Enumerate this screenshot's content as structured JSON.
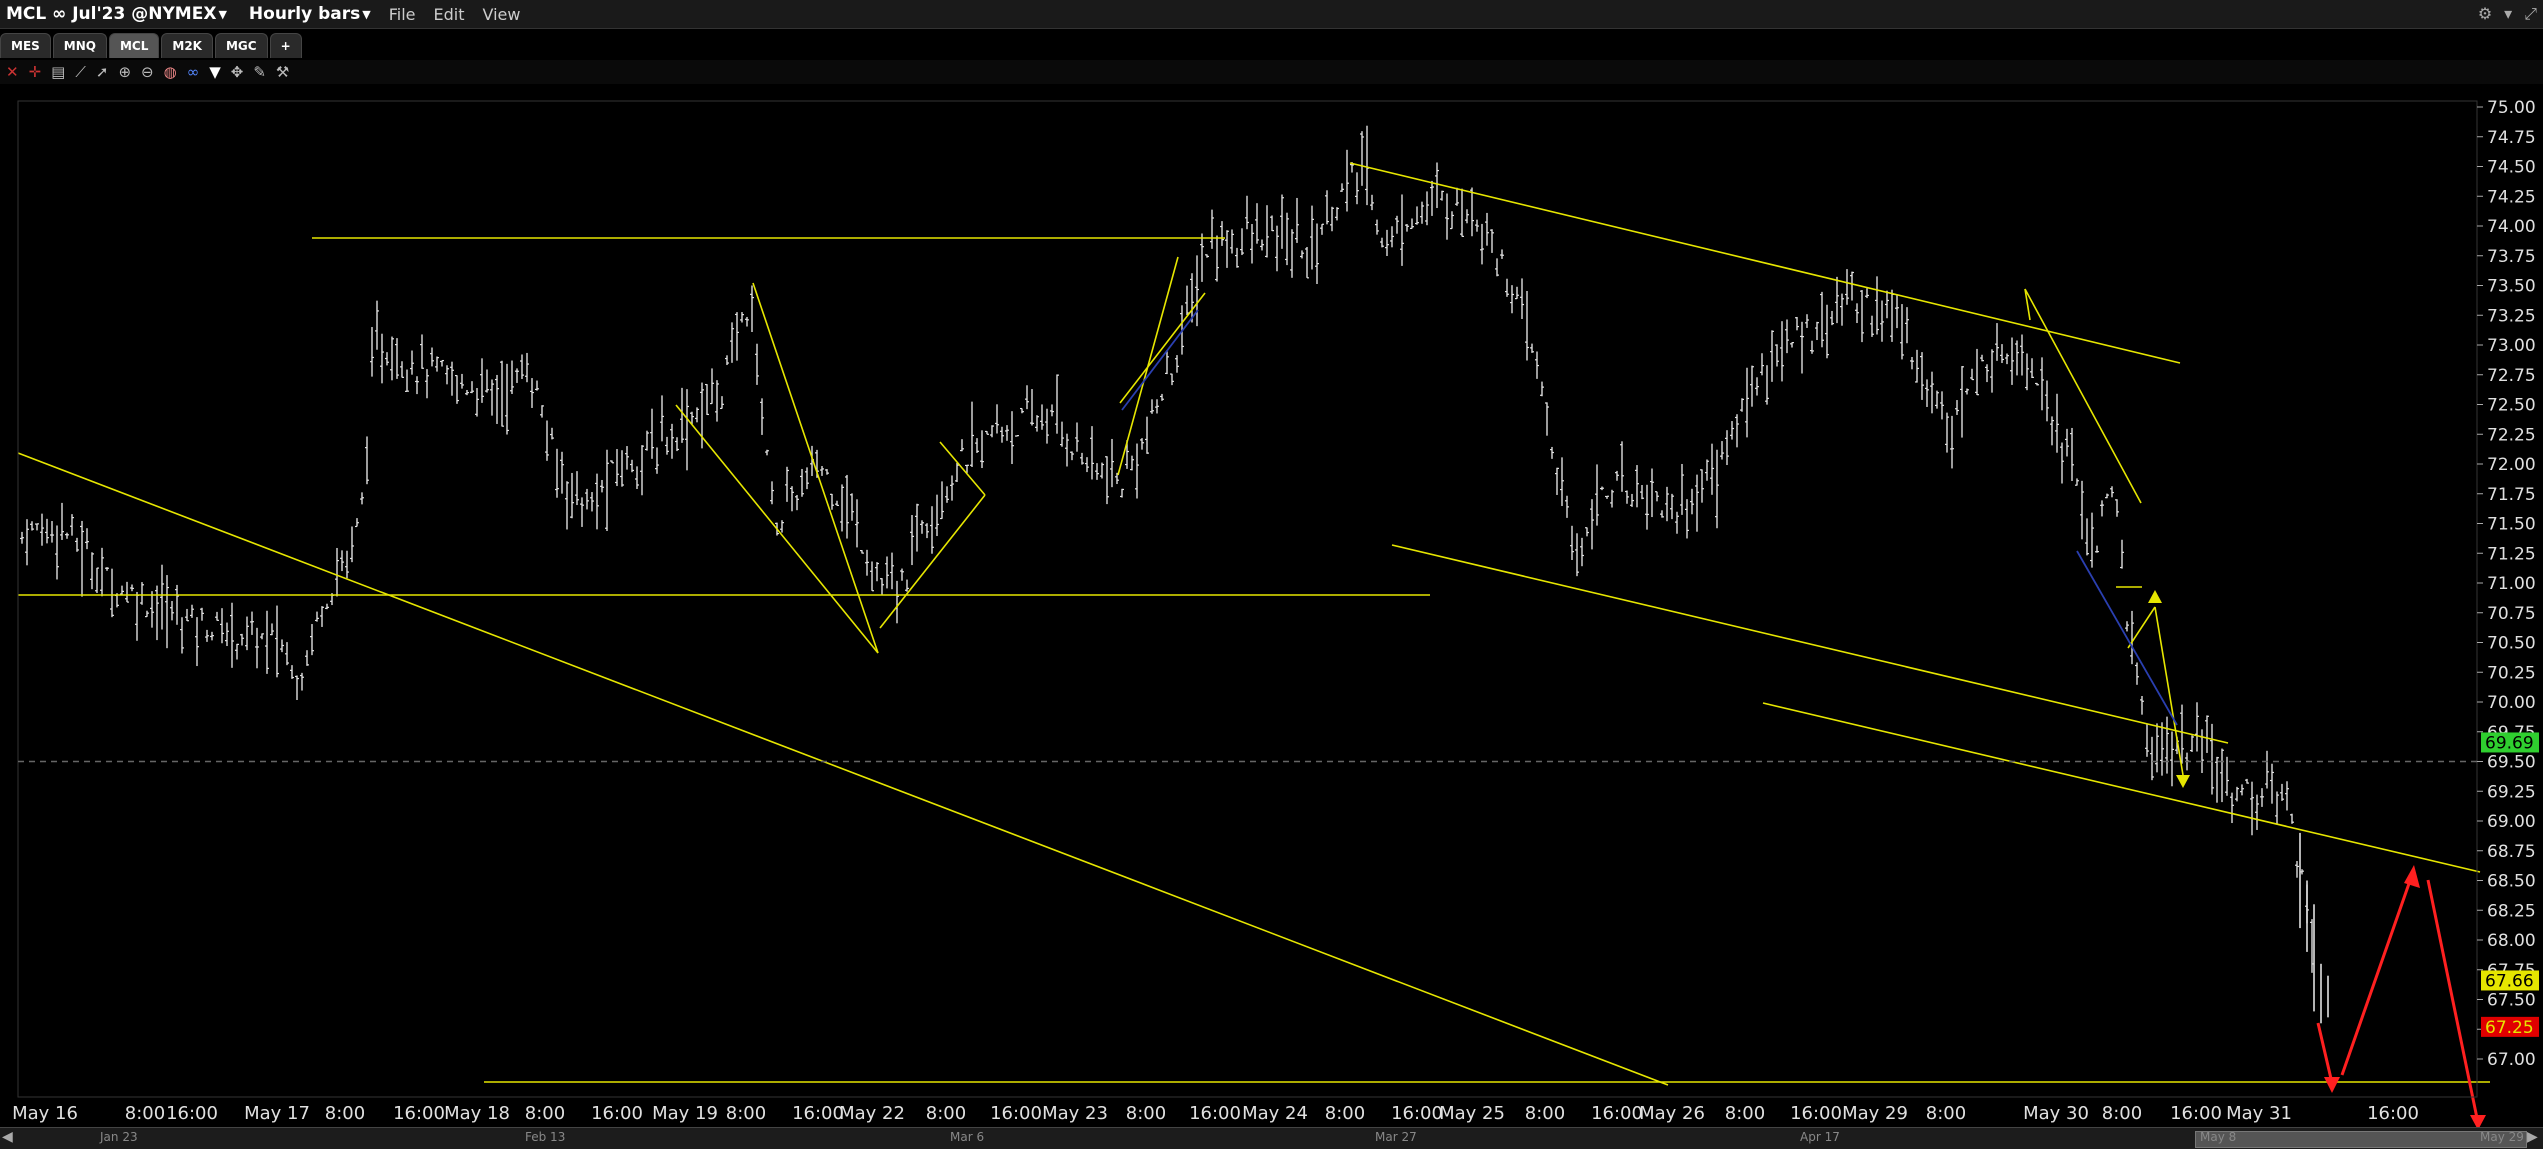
{
  "window": {
    "symbol": "MCL ∞ Jul'23 @NYMEX",
    "bar_type": "Hourly bars",
    "menu": [
      "File",
      "Edit",
      "View"
    ]
  },
  "tabs": [
    {
      "label": "MES",
      "active": false
    },
    {
      "label": "MNQ",
      "active": false
    },
    {
      "label": "MCL",
      "active": true
    },
    {
      "label": "M2K",
      "active": false
    },
    {
      "label": "MGC",
      "active": false
    },
    {
      "label": "+",
      "active": false
    }
  ],
  "toolbar_icons": [
    "close-icon",
    "crosshair-icon",
    "price-icon",
    "line-tool-icon",
    "pointer-icon",
    "zoom-in-icon",
    "zoom-out-icon",
    "globe-icon",
    "link-icon",
    "filter-icon",
    "move-icon",
    "paint-icon",
    "wrench-icon"
  ],
  "chart_data": {
    "type": "ohlc",
    "y_ticks": [
      75.0,
      74.75,
      74.5,
      74.25,
      74.0,
      73.75,
      73.5,
      73.25,
      73.0,
      72.75,
      72.5,
      72.25,
      72.0,
      71.75,
      71.5,
      71.25,
      71.0,
      70.75,
      70.5,
      70.25,
      70.0,
      69.75,
      69.5,
      69.25,
      69.0,
      68.75,
      68.5,
      68.25,
      68.0,
      67.75,
      67.5,
      67.25,
      67.0
    ],
    "y_range": [
      66.72,
      75.18
    ],
    "x_labels": [
      "May 16",
      "8:00",
      "16:00",
      "May 17",
      "8:00",
      "16:00",
      "May 18",
      "8:00",
      "16:00",
      "May 19",
      "8:00",
      "16:00",
      "May 22",
      "8:00",
      "16:00",
      "May 23",
      "8:00",
      "16:00",
      "May 24",
      "8:00",
      "16:00",
      "May 25",
      "8:00",
      "16:00",
      "May 26",
      "8:00",
      "16:00",
      "May 29",
      "8:00",
      "May 30",
      "8:00",
      "16:00",
      "May 31",
      "16:00"
    ],
    "overview_labels": [
      "Jan 23",
      "Feb 13",
      "Mar 6",
      "Mar 27",
      "Apr 17",
      "May 8",
      "May 29"
    ],
    "last_price": "69.69",
    "price_tag_yellow": "67.66",
    "price_tag_red": "67.25",
    "last_price_level": 69.5,
    "colors": {
      "trendline": "#e6e600",
      "bars": "#e0e0e0",
      "green_tag": "#2fcf2f",
      "yellow_tag": "#e6e600",
      "red_tag": "#e00000",
      "blue_line": "#2a3fb0",
      "red_arrow": "#ff2020"
    }
  }
}
